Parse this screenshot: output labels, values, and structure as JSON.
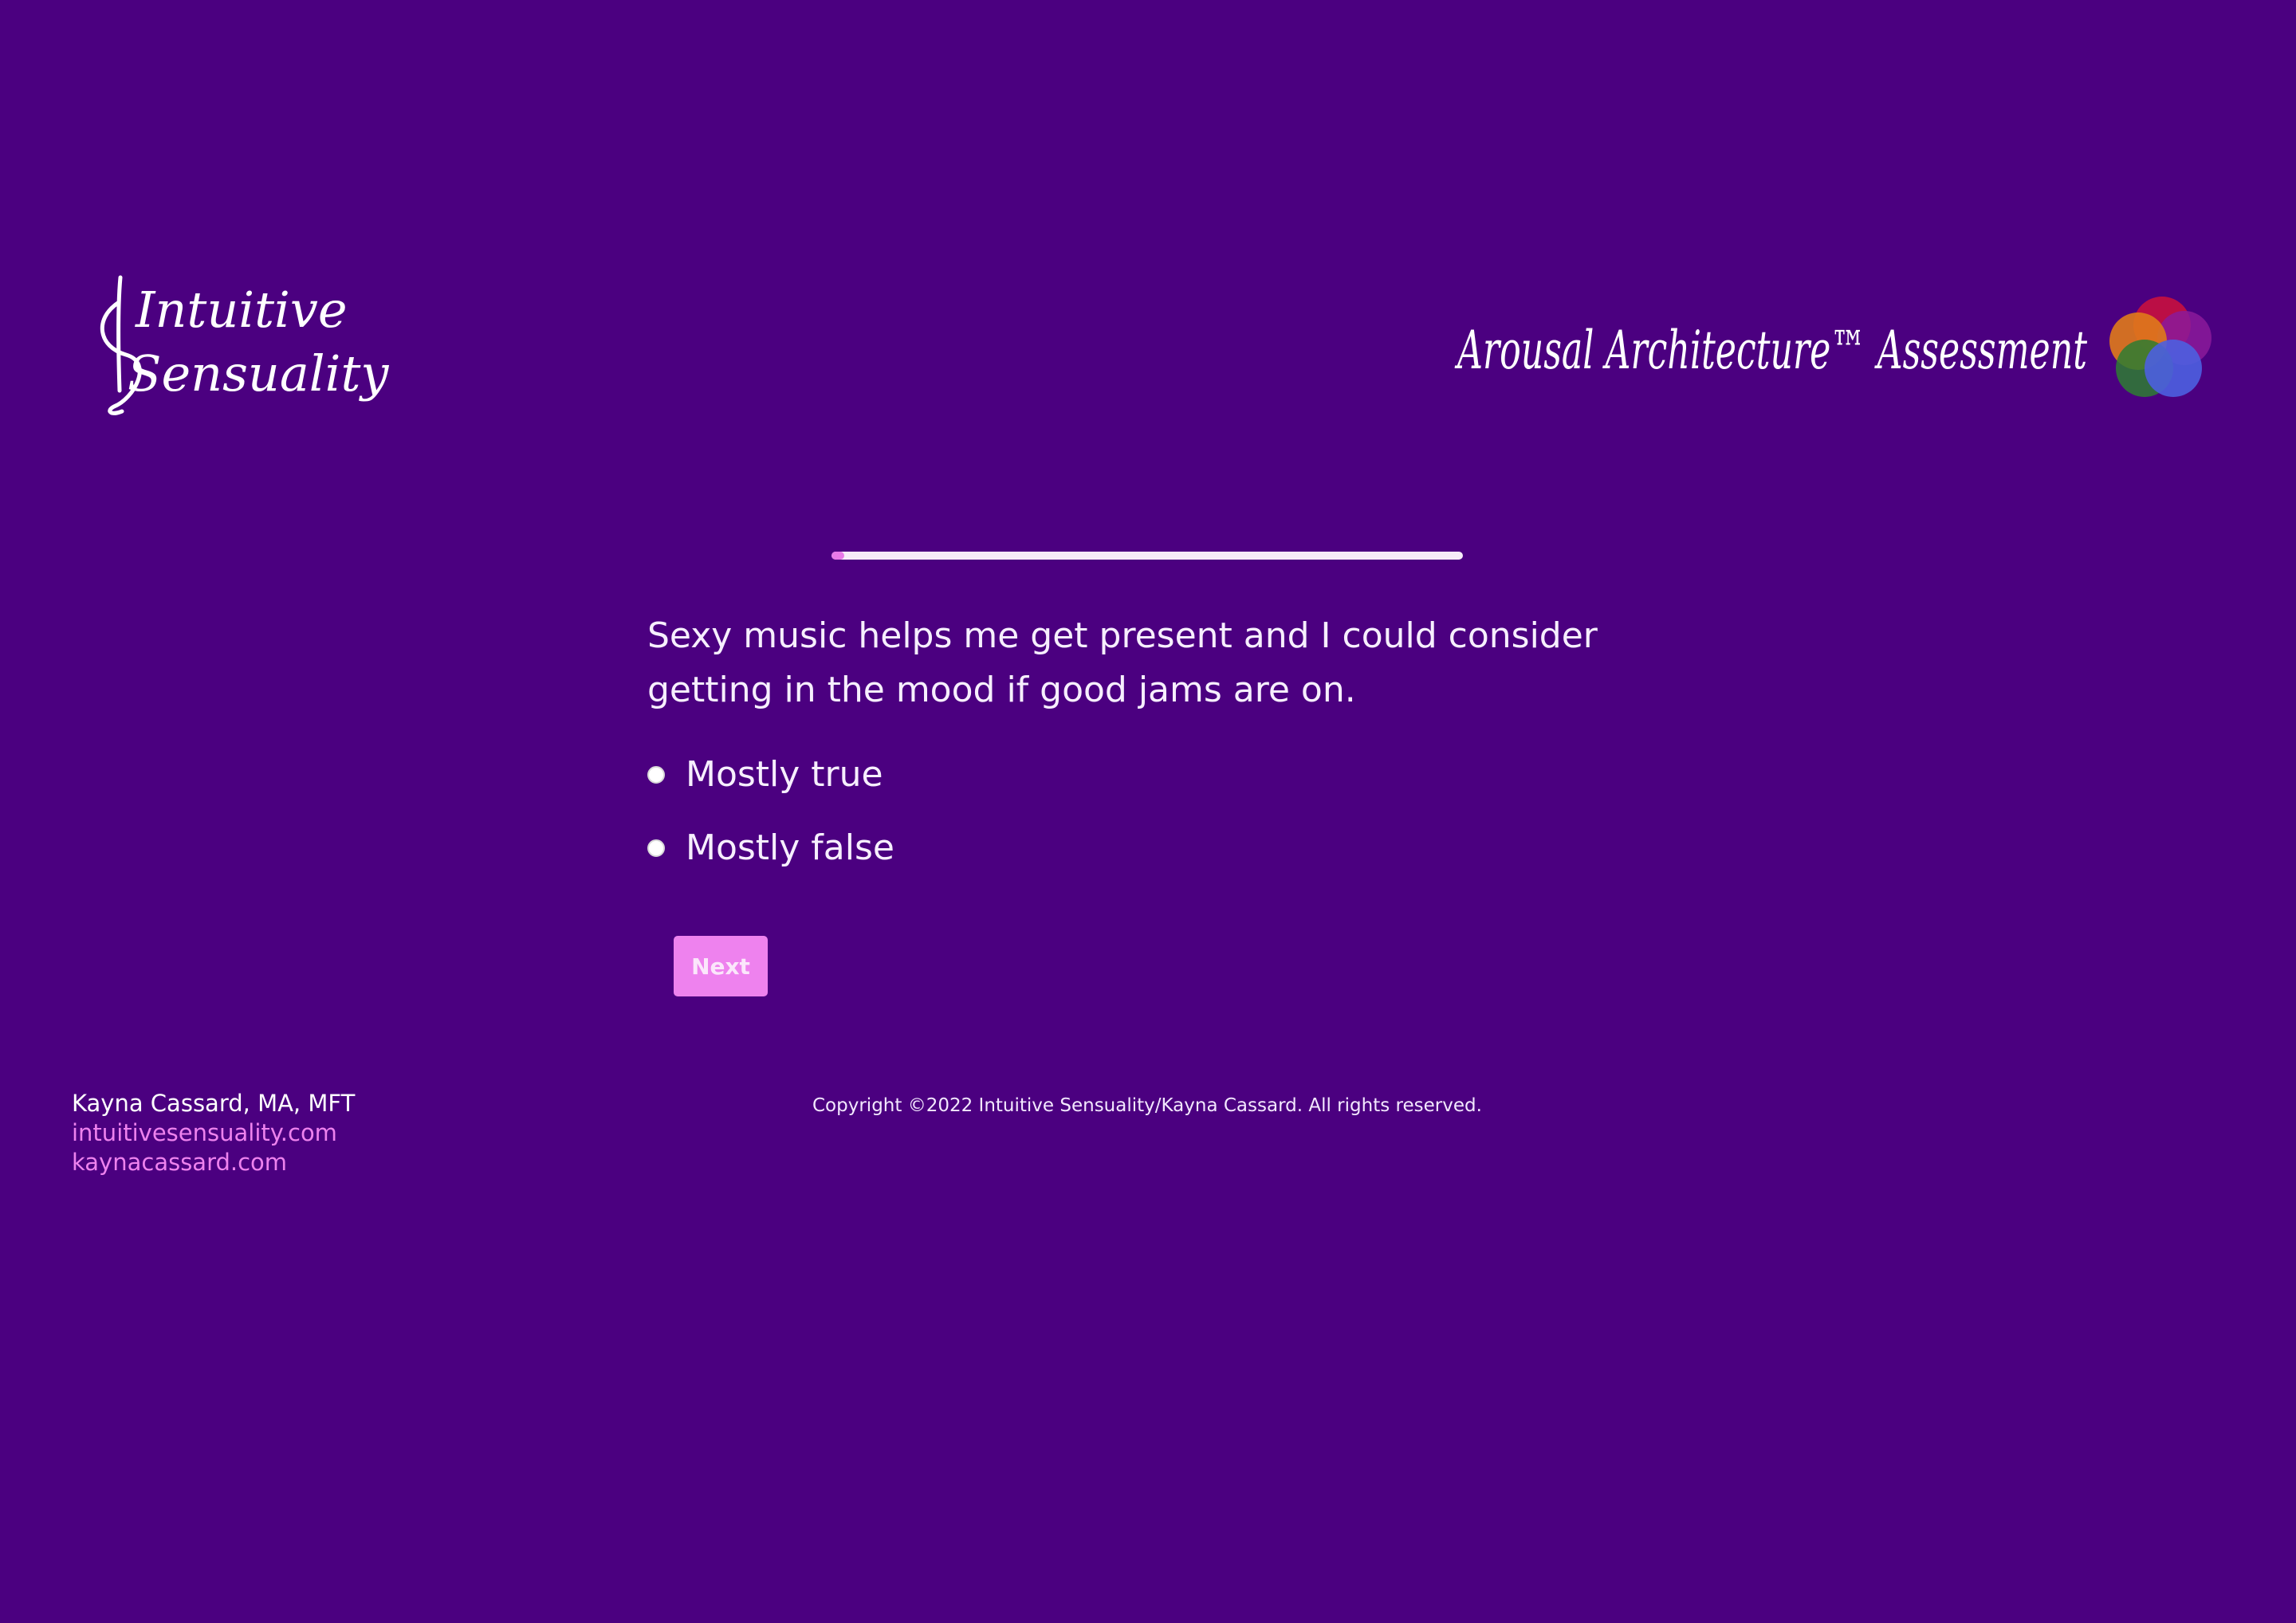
{
  "brand": {
    "left_logo_text_line1": "Intuitive",
    "left_logo_text_line2": "Sensuality",
    "right_logo_text": "Arousal Architecture™ Assessment"
  },
  "colors": {
    "background": "#4b0080",
    "accent": "#ee82ee",
    "progress_track": "#f6ecf8"
  },
  "progress": {
    "fraction": 0.02
  },
  "question": {
    "text": "Sexy music helps me get present and I could consider getting in the mood if good jams are on."
  },
  "options": [
    {
      "label": "Mostly true",
      "selected": false
    },
    {
      "label": "Mostly false",
      "selected": false
    }
  ],
  "next_button": {
    "label": "Next"
  },
  "footer": {
    "name": "Kayna Cassard, MA, MFT",
    "link1": "intuitivesensuality.com",
    "link2": "kaynacassard.com",
    "copyright": "Copyright ©2022 Intuitive Sensuality/Kayna Cassard. All rights reserved."
  }
}
